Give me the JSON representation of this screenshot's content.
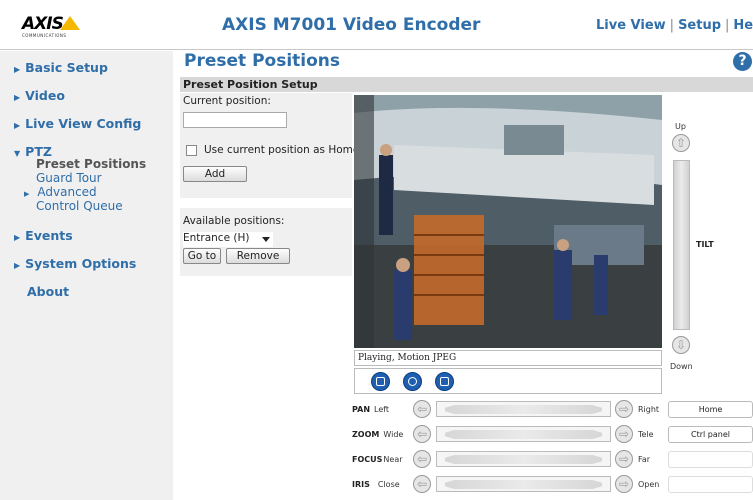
{
  "header": {
    "logo_text": "AXIS",
    "logo_sub": "COMMUNICATIONS",
    "title": "AXIS M7001 Video Encoder",
    "links": [
      "Live View",
      "Setup",
      "Help"
    ]
  },
  "sidebar": {
    "items": [
      {
        "label": "Basic Setup"
      },
      {
        "label": "Video"
      },
      {
        "label": "Live View Config"
      },
      {
        "label": "PTZ"
      },
      {
        "label": "Events"
      },
      {
        "label": "System Options"
      },
      {
        "label": "About"
      }
    ],
    "ptz_sub": [
      {
        "label": "Preset Positions"
      },
      {
        "label": "Guard Tour"
      },
      {
        "label": "Advanced"
      },
      {
        "label": "Control Queue"
      }
    ]
  },
  "main": {
    "page_title": "Preset Positions",
    "help": "?",
    "section_title": "Preset Position Setup",
    "current_position_label": "Current position:",
    "current_position_value": "",
    "use_home_label": "Use current position as Home",
    "use_home_checked": false,
    "add_label": "Add",
    "available_label": "Available positions:",
    "available_selected": "Entrance (H)",
    "goto_label": "Go to",
    "remove_label": "Remove"
  },
  "video": {
    "status": "Playing, Motion JPEG"
  },
  "ptz": {
    "tilt_up": "Up",
    "tilt_down": "Down",
    "tilt_label": "TILT",
    "rows": [
      {
        "name": "PAN",
        "left": "Left",
        "right": "Right"
      },
      {
        "name": "ZOOM",
        "left": "Wide",
        "right": "Tele"
      },
      {
        "name": "FOCUS",
        "left": "Near",
        "right": "Far"
      },
      {
        "name": "IRIS",
        "left": "Close",
        "right": "Open"
      }
    ],
    "home_label": "Home",
    "ctrl_panel_label": "Ctrl panel"
  },
  "colors": {
    "accent": "#2f6ea8",
    "sidebar_bg": "#f0f0f0",
    "section_bar": "#d8d8d8",
    "logo_triangle": "#f5b800"
  }
}
